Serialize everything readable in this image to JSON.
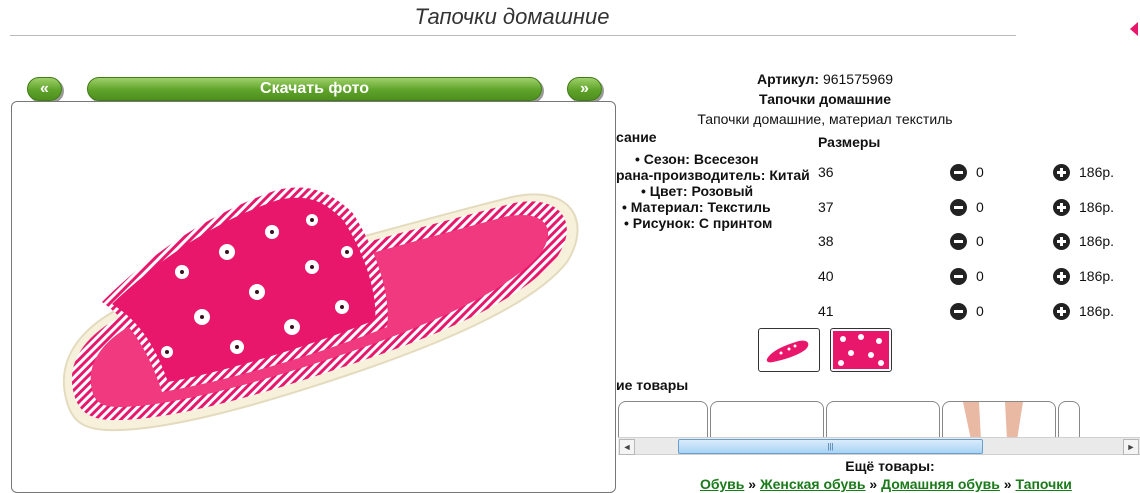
{
  "page": {
    "title": "Тапочки домашние"
  },
  "photo_nav": {
    "prev_label": "«",
    "download_label": "Скачать фото",
    "next_label": "»"
  },
  "product": {
    "article_label": "Артикул:",
    "article_value": "961575969",
    "name": "Тапочки домашние",
    "short_desc": "Тапочки домашние, материал текстиль"
  },
  "description": {
    "heading_visible": "сание",
    "items": [
      "• Сезон: Всесезон",
      "рана-производитель: Китай",
      "• Цвет: Розовый",
      "• Материал: Текстиль",
      "• Рисунок: С принтом"
    ]
  },
  "sizes": {
    "heading": "Размеры",
    "rows": [
      {
        "size": "36",
        "qty": "0",
        "price": "186р."
      },
      {
        "size": "37",
        "qty": "0",
        "price": "186р."
      },
      {
        "size": "38",
        "qty": "0",
        "price": "186р."
      },
      {
        "size": "40",
        "qty": "0",
        "price": "186р."
      },
      {
        "size": "41",
        "qty": "0",
        "price": "186р."
      }
    ]
  },
  "similar": {
    "heading_visible": "ие товары"
  },
  "scrollbar": {
    "left_arrow": "◄",
    "right_arrow": "►",
    "grip": "|||"
  },
  "more": {
    "heading": "Ещё товары:",
    "crumbs": [
      "Обувь",
      "Женская обувь",
      "Домашняя обувь",
      "Тапочки"
    ],
    "separator": "»"
  },
  "colors": {
    "accent_green": "#5ea32a",
    "slipper_pink": "#e8176c",
    "link_green": "#1a7a1a"
  }
}
